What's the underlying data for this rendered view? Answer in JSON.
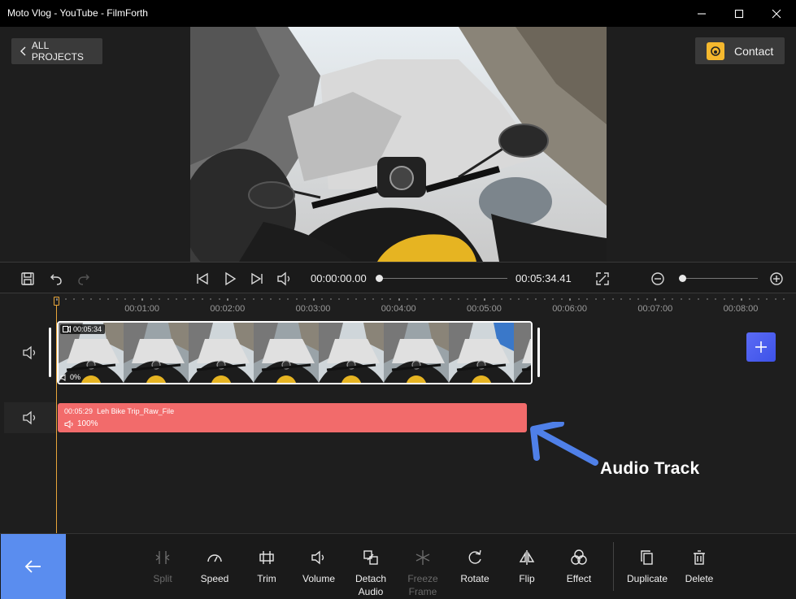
{
  "window": {
    "title": "Moto Vlog - YouTube - FilmForth",
    "minimize_icon": "minimize-icon",
    "maximize_icon": "maximize-icon",
    "close_icon": "close-icon"
  },
  "header": {
    "all_projects_label": "ALL PROJECTS",
    "contact_label": "Contact"
  },
  "transport": {
    "current_time": "00:00:00.00",
    "total_time": "00:05:34.41",
    "zoom_level": 0.04,
    "playback_position": 0
  },
  "ruler": {
    "labels": [
      "00:01:00",
      "00:02:00",
      "00:03:00",
      "00:04:00",
      "00:05:00",
      "00:06:00",
      "00:07:00",
      "00:08:00"
    ]
  },
  "video_track": {
    "clip_duration": "00:05:34",
    "clip_volume": "0%"
  },
  "audio_track": {
    "clip_duration": "00:05:29",
    "clip_name": "Leh Bike Trip_Raw_File",
    "clip_volume": "100%"
  },
  "annotation": {
    "label": "Audio Track"
  },
  "toolbar": {
    "tools": [
      {
        "label": "Split",
        "icon": "split-icon",
        "disabled": true
      },
      {
        "label": "Speed",
        "icon": "speed-icon",
        "disabled": false
      },
      {
        "label": "Trim",
        "icon": "trim-icon",
        "disabled": false
      },
      {
        "label": "Volume",
        "icon": "volume-icon",
        "disabled": false
      },
      {
        "label": "Detach Audio",
        "icon": "detach-audio-icon",
        "disabled": false
      },
      {
        "label": "Freeze Frame",
        "icon": "freeze-frame-icon",
        "disabled": true
      },
      {
        "label": "Rotate",
        "icon": "rotate-icon",
        "disabled": false
      },
      {
        "label": "Flip",
        "icon": "flip-icon",
        "disabled": false
      },
      {
        "label": "Effect",
        "icon": "effect-icon",
        "disabled": false
      },
      {
        "label": "Duplicate",
        "icon": "duplicate-icon",
        "disabled": false
      },
      {
        "label": "Delete",
        "icon": "delete-icon",
        "disabled": false
      }
    ]
  },
  "colors": {
    "accent": "#5a8def",
    "audio_clip": "#f26b6b",
    "playhead": "#e8a63a",
    "add_button": "#4a5cf0"
  }
}
